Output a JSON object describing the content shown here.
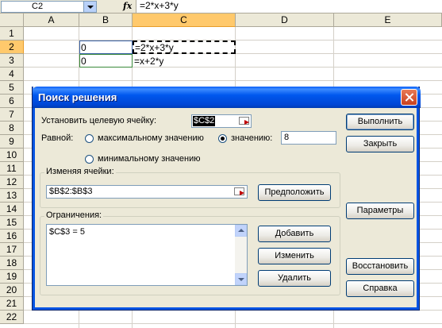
{
  "formula_bar": {
    "name_box": "C2",
    "fx_label": "fx",
    "formula": "=2*x+3*y"
  },
  "columns": [
    "A",
    "B",
    "C",
    "D",
    "E"
  ],
  "active_column": "C",
  "rows": [
    "1",
    "2",
    "3",
    "4",
    "5",
    "6",
    "7",
    "8",
    "9",
    "10",
    "11",
    "12",
    "13",
    "14",
    "15",
    "16",
    "17",
    "18",
    "19",
    "20",
    "21",
    "22"
  ],
  "active_row": "2",
  "cells": {
    "b2": "0",
    "b3": "0",
    "c2": "=2*x+3*y",
    "c3": "=x+2*y"
  },
  "dialog": {
    "title": "Поиск решения",
    "target_label": "Установить целевую ячейку:",
    "target_value": "$C$2",
    "equal_label": "Равной:",
    "radio_max": "максимальному значению",
    "radio_min": "минимальному значению",
    "radio_value": "значению:",
    "value_field": "8",
    "selected_radio": "value",
    "changing_label": "Изменяя ячейки:",
    "changing_value": "$B$2:$B$3",
    "guess_button": "Предположить",
    "constraints_label": "Ограничения:",
    "constraints": [
      "$C$3 = 5"
    ],
    "add_button": "Добавить",
    "change_button": "Изменить",
    "delete_button": "Удалить",
    "solve_button": "Выполнить",
    "close_button": "Закрыть",
    "options_button": "Параметры",
    "reset_button": "Восстановить",
    "help_button": "Справка"
  }
}
